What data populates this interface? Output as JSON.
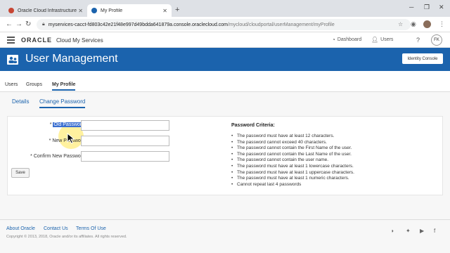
{
  "browser": {
    "tabs": [
      {
        "title": "Oracle Cloud Infrastructure",
        "active": false
      },
      {
        "title": "My Profile",
        "active": true
      }
    ],
    "new_tab": "+",
    "close": "✕",
    "url_domain": "myservices-cacct-fd803c42e21f48e997d49bdda641879a.console.oraclecloud.com",
    "url_path": "/mycloud/cloudportal/userManagement/myProfile"
  },
  "header": {
    "logo": "ORACLE",
    "service": "Cloud My Services",
    "nav": [
      {
        "label": "Dashboard",
        "icon": "dashboard-icon"
      },
      {
        "label": "Users",
        "icon": "users-icon"
      }
    ],
    "help": "?",
    "user_initials": "FK"
  },
  "titlebar": {
    "title": "User Management",
    "identity_console": "Identity Console"
  },
  "primary_tabs": [
    "Users",
    "Groups",
    "My Profile"
  ],
  "secondary_tabs": [
    "Details",
    "Change Password"
  ],
  "form": {
    "required_mark": "*",
    "fields": [
      {
        "label": "Old Password",
        "value": ""
      },
      {
        "label": "New Password",
        "value": ""
      },
      {
        "label": "Confirm New Password",
        "value": ""
      }
    ],
    "save_label": "Save"
  },
  "criteria": {
    "title": "Password Criteria:",
    "items": [
      "The password must have at least 12 characters.",
      "The password cannot exceed 40 characters.",
      "The password cannot contain the First Name of the user.",
      "The password cannot contain the Last Name of the user.",
      "The password cannot contain the user name.",
      "The password must have at least 1 lowercase characters.",
      "The password must have at least 1 uppercase characters.",
      "The password must have at least 1 numeric characters.",
      "Cannot repeat last 4 passwords"
    ]
  },
  "footer": {
    "links": [
      "About Oracle",
      "Contact Us",
      "Terms Of Use"
    ],
    "copyright": "Copyright © 2013, 2018, Oracle and/or its affiliates. All rights reserved."
  },
  "colors": {
    "brand_blue": "#1b63ad",
    "selection": "#3b6fd0"
  }
}
